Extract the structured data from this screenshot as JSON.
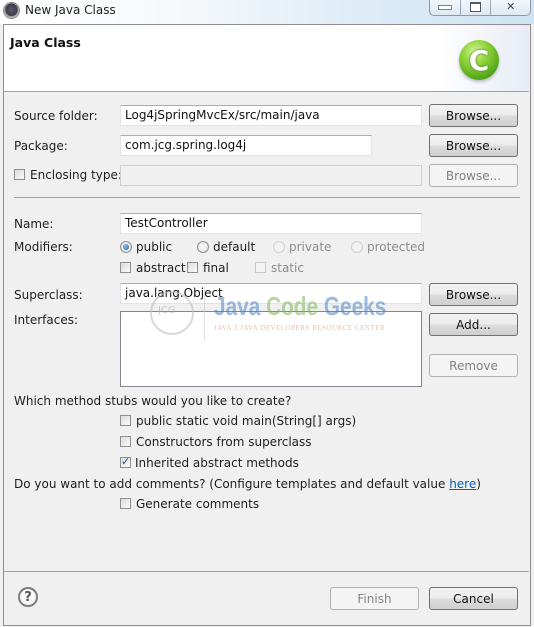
{
  "window": {
    "title": "New Java Class",
    "controls": {
      "minimize": "minimize",
      "maximize": "maximize",
      "close": "✕"
    }
  },
  "header": {
    "title": "Java Class",
    "icon": "class-icon",
    "icon_glyph": "C"
  },
  "form": {
    "source_folder": {
      "label": "Source folder:",
      "value": "Log4jSpringMvcEx/src/main/java",
      "browse": "Browse..."
    },
    "package": {
      "label": "Package:",
      "value": "com.jcg.spring.log4j",
      "browse": "Browse..."
    },
    "enclosing_type": {
      "label": "Enclosing type:",
      "checked": false,
      "value": "",
      "browse": "Browse..."
    },
    "name": {
      "label": "Name:",
      "value": "TestController"
    },
    "modifiers": {
      "label": "Modifiers:",
      "radios": [
        {
          "label": "public",
          "checked": true,
          "enabled": true
        },
        {
          "label": "default",
          "checked": false,
          "enabled": true
        },
        {
          "label": "private",
          "checked": false,
          "enabled": false
        },
        {
          "label": "protected",
          "checked": false,
          "enabled": false
        }
      ],
      "checkboxes": [
        {
          "label": "abstract",
          "checked": false,
          "enabled": true
        },
        {
          "label": "final",
          "checked": false,
          "enabled": true
        },
        {
          "label": "static",
          "checked": false,
          "enabled": false
        }
      ]
    },
    "superclass": {
      "label": "Superclass:",
      "value": "java.lang.Object",
      "browse": "Browse..."
    },
    "interfaces": {
      "label": "Interfaces:",
      "items": [],
      "add": "Add...",
      "remove": "Remove"
    },
    "method_stubs": {
      "question": "Which method stubs would you like to create?",
      "options": [
        {
          "label": "public static void main(String[] args)",
          "checked": false
        },
        {
          "label": "Constructors from superclass",
          "checked": false
        },
        {
          "label": "Inherited abstract methods",
          "checked": true
        }
      ]
    },
    "comments": {
      "question_prefix": "Do you want to add comments? (Configure templates and default value ",
      "link": "here",
      "question_suffix": ")",
      "option": {
        "label": "Generate comments",
        "checked": false
      }
    }
  },
  "watermark": {
    "logo": "JCG",
    "word1": "Java",
    "word2": "Code",
    "word3": "Geeks",
    "subtitle": "JAVA 2 JAVA DEVELOPERS RESOURCE CENTER"
  },
  "footer": {
    "help_icon": "?",
    "finish": "Finish",
    "cancel": "Cancel"
  }
}
